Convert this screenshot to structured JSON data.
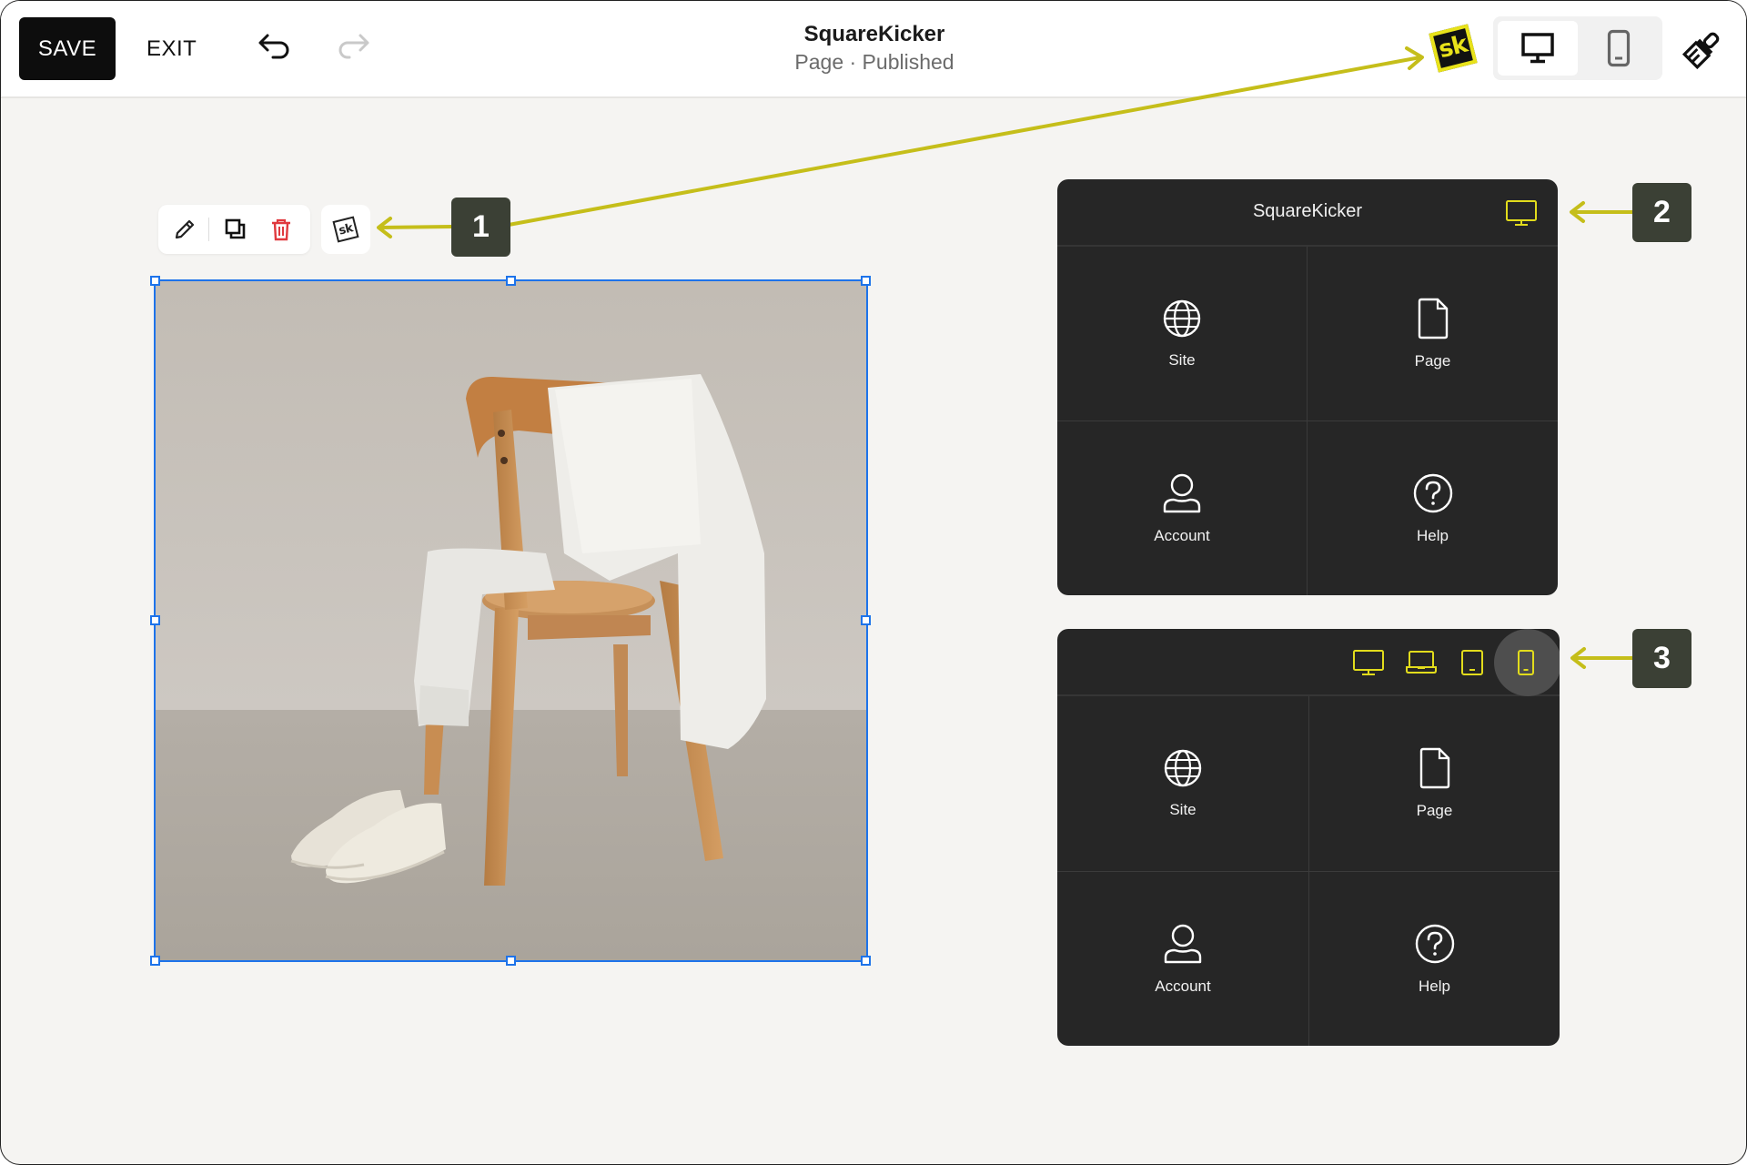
{
  "topbar": {
    "save_label": "SAVE",
    "exit_label": "EXIT",
    "undo_icon": "undo-icon",
    "redo_icon": "redo-icon",
    "site_title": "SquareKicker",
    "page_status": "Page · Published",
    "sk_logo_text": "sk",
    "device_toggle": {
      "options": [
        "desktop",
        "mobile"
      ],
      "selected": "desktop"
    },
    "style_icon": "paintbrush-icon"
  },
  "block_toolbar": {
    "actions": [
      {
        "name": "edit",
        "icon": "pencil-icon"
      },
      {
        "name": "duplicate",
        "icon": "duplicate-icon"
      },
      {
        "name": "delete",
        "icon": "trash-icon"
      }
    ],
    "sk_button_text": "sk"
  },
  "image_block": {
    "description": "Wooden chair with white sweatshirt and sweatpants, white sneakers on floor",
    "selected": true
  },
  "annotations": {
    "badge_1": "1",
    "badge_2": "2",
    "badge_3": "3",
    "arrow_color": "#c5be1a"
  },
  "panel_desktop": {
    "title": "SquareKicker",
    "device_icon": "desktop-icon",
    "items": [
      {
        "label": "Site",
        "icon": "globe-icon"
      },
      {
        "label": "Page",
        "icon": "page-icon"
      },
      {
        "label": "Account",
        "icon": "user-icon"
      },
      {
        "label": "Help",
        "icon": "help-icon"
      }
    ]
  },
  "panel_devices": {
    "devices": [
      {
        "name": "desktop",
        "icon": "desktop-icon"
      },
      {
        "name": "laptop",
        "icon": "laptop-icon"
      },
      {
        "name": "tablet",
        "icon": "tablet-icon"
      },
      {
        "name": "mobile",
        "icon": "mobile-icon"
      }
    ],
    "selected_device": "mobile",
    "items": [
      {
        "label": "Site",
        "icon": "globe-icon"
      },
      {
        "label": "Page",
        "icon": "page-icon"
      },
      {
        "label": "Account",
        "icon": "user-icon"
      },
      {
        "label": "Help",
        "icon": "help-icon"
      }
    ]
  },
  "colors": {
    "accent_yellow": "#e2dc1c",
    "panel_bg": "#262626",
    "badge_bg": "#3b4035",
    "selection_blue": "#1d73ea",
    "delete_red": "#e0393e"
  }
}
